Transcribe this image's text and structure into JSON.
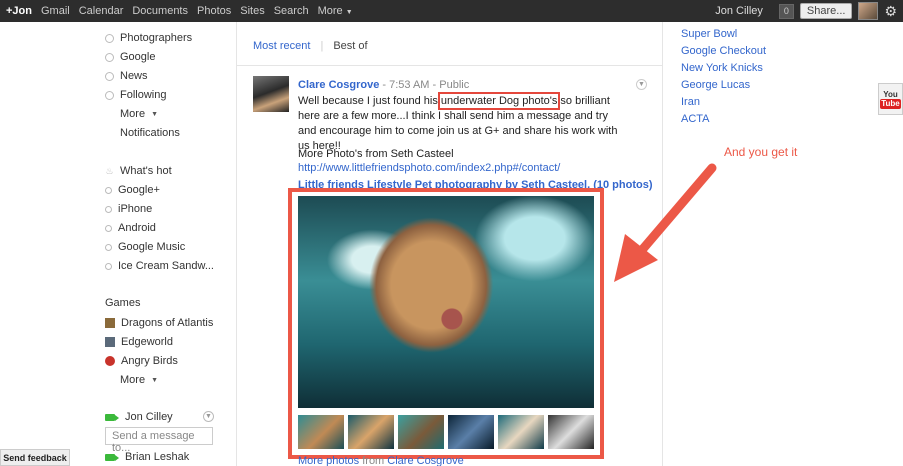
{
  "topbar": {
    "nav": [
      "+Jon",
      "Gmail",
      "Calendar",
      "Documents",
      "Photos",
      "Sites",
      "Search",
      "More"
    ],
    "user": "Jon Cilley",
    "notifications": "0",
    "share": "Share..."
  },
  "sidebar": {
    "circles": [
      "Photographers",
      "Google",
      "News",
      "Following"
    ],
    "circles_more": "More",
    "notifications": "Notifications",
    "searches": [
      "What's hot",
      "Google+",
      "iPhone",
      "Android",
      "Google Music",
      "Ice Cream Sandw..."
    ],
    "games_title": "Games",
    "games": [
      "Dragons of Atlantis",
      "Edgeworld",
      "Angry Birds"
    ],
    "games_more": "More",
    "chat_user": "Jon Cilley",
    "chat_placeholder": "Send a message to...",
    "chat_contact": "Brian Leshak",
    "feedback": "Send feedback"
  },
  "stream": {
    "tab_active": "Most recent",
    "tab_other": "Best of"
  },
  "post": {
    "author": "Clare Cosgrove",
    "time": "7:53 AM",
    "visibility": "Public",
    "text_before": "Well because I just found his ",
    "highlight": "underwater Dog photo's",
    "text_after": " so brilliant here are a few more...I think I shall send him a message and try and encourage him to come join us at G+ and share his work with us here!!",
    "more_from": "More Photo's from Seth Casteel",
    "link": "http://www.littlefriendsphoto.com/index2.php#/contact/",
    "album_title": "Little friends Lifestyle Pet photography by Seth Casteel. (10 photos)",
    "more_photos": "More photos",
    "from_label": "from",
    "from_name": "Clare Cosgrove"
  },
  "trending": [
    "Super Bowl",
    "Google Checkout",
    "New York Knicks",
    "George Lucas",
    "Iran",
    "ACTA"
  ],
  "youtube": {
    "you": "You",
    "tube": "Tube"
  },
  "annotation": "And you get it",
  "colors": {
    "accent": "#ec5847",
    "link": "#3366cc",
    "topbar": "#2d2d2d"
  },
  "icons": [
    "settings-gear-icon",
    "camera-icon",
    "circle-icon",
    "search-icon",
    "flame-icon",
    "youtube-icon"
  ]
}
